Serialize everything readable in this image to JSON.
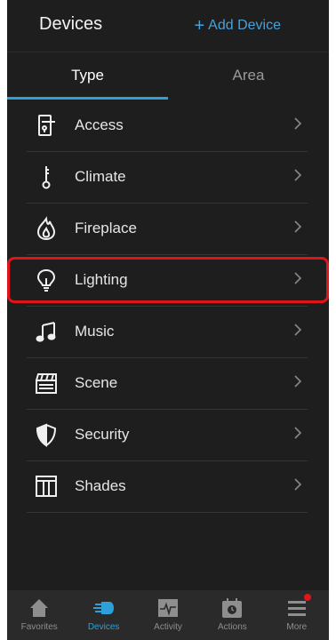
{
  "header": {
    "title": "Devices",
    "add_button": "Add Device",
    "add_icon": "plus-icon"
  },
  "tabs": [
    {
      "label": "Type",
      "active": true
    },
    {
      "label": "Area",
      "active": false
    }
  ],
  "device_types": [
    {
      "label": "Access",
      "icon": "door-lock-icon"
    },
    {
      "label": "Climate",
      "icon": "thermometer-icon"
    },
    {
      "label": "Fireplace",
      "icon": "flame-icon"
    },
    {
      "label": "Lighting",
      "icon": "lightbulb-icon",
      "highlighted": true
    },
    {
      "label": "Music",
      "icon": "music-note-icon"
    },
    {
      "label": "Scene",
      "icon": "clapperboard-icon"
    },
    {
      "label": "Security",
      "icon": "shield-icon"
    },
    {
      "label": "Shades",
      "icon": "window-shade-icon"
    }
  ],
  "bottom_nav": [
    {
      "label": "Favorites",
      "icon": "home-icon",
      "active": false
    },
    {
      "label": "Devices",
      "icon": "devices-plug-icon",
      "active": true
    },
    {
      "label": "Activity",
      "icon": "activity-icon",
      "active": false
    },
    {
      "label": "Actions",
      "icon": "calendar-icon",
      "active": false
    },
    {
      "label": "More",
      "icon": "menu-icon",
      "active": false,
      "badge": true
    }
  ],
  "colors": {
    "accent": "#2d9fd9",
    "highlight": "#e0151b",
    "background": "#1e1e1e"
  }
}
